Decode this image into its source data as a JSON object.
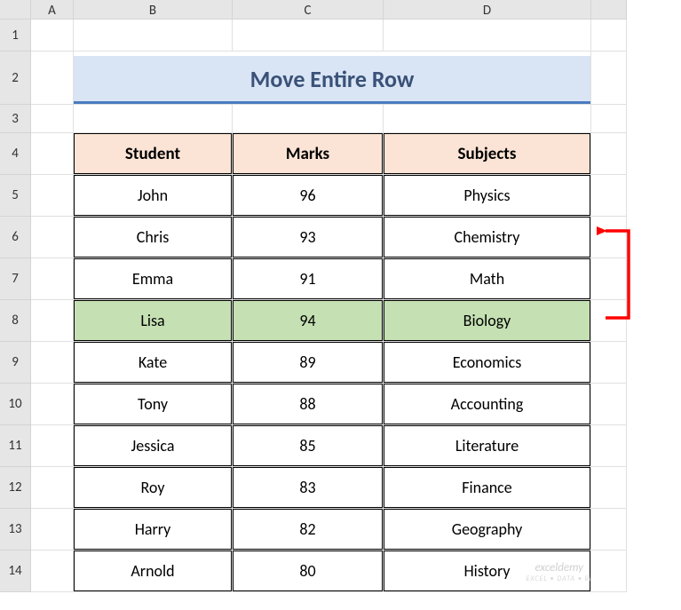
{
  "columns": [
    "A",
    "B",
    "C",
    "D"
  ],
  "title": "Move Entire Row",
  "table": {
    "headers": [
      "Student",
      "Marks",
      "Subjects"
    ],
    "rows": [
      {
        "student": "John",
        "marks": "96",
        "subject": "Physics",
        "highlighted": false
      },
      {
        "student": "Chris",
        "marks": "93",
        "subject": "Chemistry",
        "highlighted": false
      },
      {
        "student": "Emma",
        "marks": "91",
        "subject": "Math",
        "highlighted": false
      },
      {
        "student": "Lisa",
        "marks": "94",
        "subject": "Biology",
        "highlighted": true
      },
      {
        "student": "Kate",
        "marks": "89",
        "subject": "Economics",
        "highlighted": false
      },
      {
        "student": "Tony",
        "marks": "88",
        "subject": "Accounting",
        "highlighted": false
      },
      {
        "student": "Jessica",
        "marks": "85",
        "subject": "Literature",
        "highlighted": false
      },
      {
        "student": "Roy",
        "marks": "83",
        "subject": "Finance",
        "highlighted": false
      },
      {
        "student": "Harry",
        "marks": "82",
        "subject": "Geography",
        "highlighted": false
      },
      {
        "student": "Arnold",
        "marks": "80",
        "subject": "History",
        "highlighted": false
      }
    ]
  },
  "rowNumbers": [
    "1",
    "2",
    "3",
    "4",
    "5",
    "6",
    "7",
    "8",
    "9",
    "10",
    "11",
    "12",
    "13",
    "14"
  ],
  "arrow": {
    "color": "#ff0000",
    "fromRow": 8,
    "toRow": 6
  },
  "watermark": {
    "main": "exceldemy",
    "sub": "EXCEL • DATA • BI"
  },
  "colors": {
    "titleBg": "#d9e5f5",
    "titleBorder": "#4a7cbf",
    "headerBg": "#fbe4d5",
    "highlightBg": "#c5e0b3"
  }
}
